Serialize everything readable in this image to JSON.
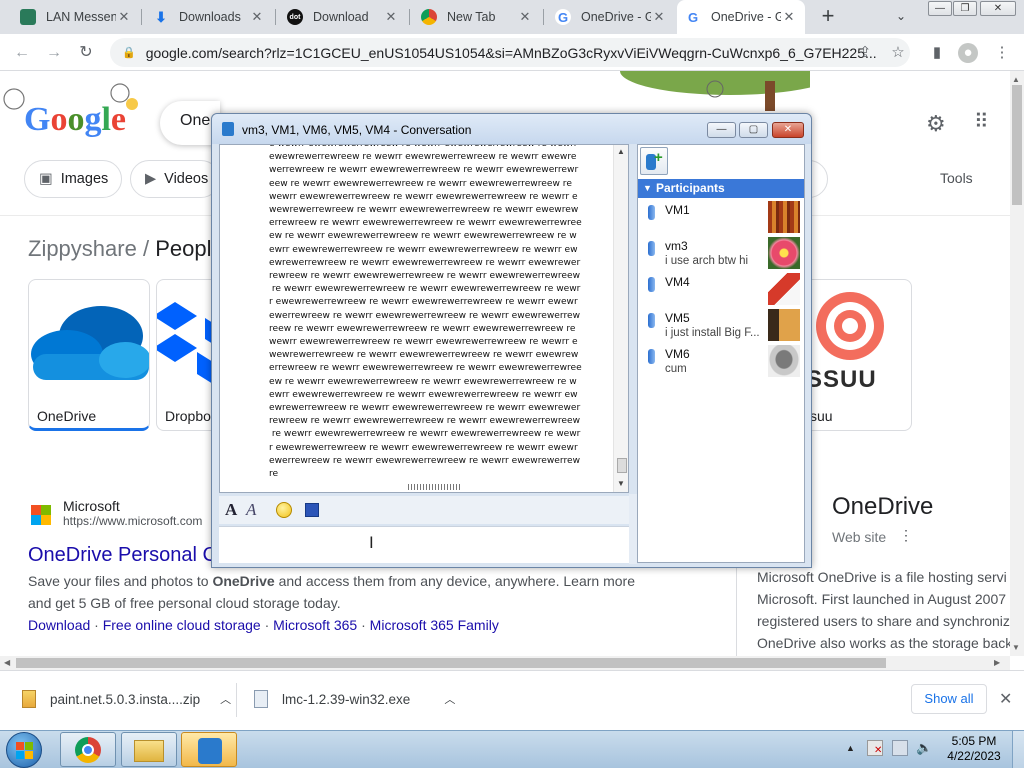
{
  "tabs": [
    {
      "label": "LAN Messen",
      "icon": "lan-messenger-icon"
    },
    {
      "label": "Downloads",
      "icon": "download-icon"
    },
    {
      "label": "Download",
      "icon": "dot-icon"
    },
    {
      "label": "New Tab",
      "icon": "chrome-icon"
    },
    {
      "label": "OneDrive - G",
      "icon": "google-icon"
    },
    {
      "label": "OneDrive - G",
      "icon": "google-icon",
      "active": true
    }
  ],
  "browser": {
    "url": "google.com/search?rlz=1C1GCEU_enUS1054US1054&si=AMnBZoG3cRyxvViEiVWeqgrn-CuWcnxp6_6_G7EH225...",
    "new_tab": "+",
    "tab_close": "✕"
  },
  "google": {
    "logo": "Google",
    "query": "One",
    "chips": [
      "Images",
      "Videos"
    ],
    "tools": "Tools",
    "breadcrumb": [
      "Zippyshare",
      "/",
      "People"
    ],
    "cards": [
      "OneDrive",
      "Dropbo",
      "suu"
    ],
    "issuu_text": "SSUU",
    "result": {
      "site": "Microsoft",
      "url": "https://www.microsoft.com",
      "title": "OneDrive Personal C",
      "snippet_pre": "Save your files and photos to ",
      "snippet_bold": "OneDrive",
      "snippet_post": " and access them from any device, anywhere. Learn more",
      "snippet_line2": "and get 5 GB of free personal cloud storage today.",
      "links": [
        "Download",
        "Free online cloud storage",
        "Microsoft 365",
        "Microsoft 365 Family"
      ],
      "separator": "·"
    },
    "kp": {
      "title": "OneDrive",
      "subtitle": "Web site",
      "more": "⋮",
      "lines": [
        "Microsoft OneDrive is a file hosting servi",
        "Microsoft. First launched in August 2007",
        "registered users to share and synchroniz",
        "OneDrive also works as the storage back"
      ]
    }
  },
  "conversation": {
    "title": "vm3, VM1, VM6, VM5, VM4 - Conversation",
    "message_lines": [
      "e wewrr ewewrewerrewreew re wewrr ewewrewerrewreew re wewrr",
      "ewewrewerrewreew re wewrr ewewrewerrewreew re wewrr ewewre",
      "werrewreew re wewrr ewewrewerrewreew re wewrr ewewrewerrewr",
      "eew re wewrr ewewrewerrewreew re wewrr ewewrewerrewreew re",
      "wewrr ewewrewerrewreew re wewrr ewewrewerrewreew re wewrr e",
      "wewrewerrewreew re wewrr ewewrewerrewreew re wewrr ewewrew",
      "errewreew re wewrr ewewrewerrewreew re wewrr ewewrewerrewree",
      "ew re wewrr ewewrewerrewreew re wewrr ewewrewerrewreew re w",
      "ewrr ewewrewerrewreew re wewrr ewewrewerrewreew re wewrr ew",
      "ewrewerrewreew re wewrr ewewrewerrewreew re wewrr ewewrewer",
      "rewreew re wewrr ewewrewerrewreew re wewrr ewewrewerrewreew",
      " re wewrr ewewrewerrewreew re wewrr ewewrewerrewreew re wewr",
      "r ewewrewerrewreew re wewrr ewewrewerrewreew re wewrr ewewr",
      "ewerrewreew re wewrr ewewrewerrewreew re wewrr ewewrewerrew",
      "reew re wewrr ewewrewerrewreew re wewrr ewewrewerrewreew re",
      "wewrr ewewrewerrewreew re wewrr ewewrewerrewreew re wewrr e",
      "wewrewerrewreew re wewrr ewewrewerrewreew re wewrr ewewrew",
      "errewreew re wewrr ewewrewerrewreew re wewrr ewewrewerrewree",
      "ew re wewrr ewewrewerrewreew re wewrr ewewrewerrewreew re w",
      "ewrr ewewrewerrewreew re wewrr ewewrewerrewreew re wewrr ew",
      "ewrewerrewreew re wewrr ewewrewerrewreew re wewrr ewewrewer",
      "rewreew re wewrr ewewrewerrewreew re wewrr ewewrewerrewreew",
      " re wewrr ewewrewerrewreew re wewrr ewewrewerrewreew re wewr",
      "r ewewrewerrewreew re wewrr ewewrewerrewreew re wewrr ewewr",
      "ewerrewreew re wewrr ewewrewerrewreew re wewrr ewewrewerrew",
      "re"
    ],
    "participants_header": "Participants",
    "participants": [
      {
        "name": "VM1",
        "status": ""
      },
      {
        "name": "vm3",
        "status": "i use arch btw hi"
      },
      {
        "name": "VM4",
        "status": ""
      },
      {
        "name": "VM5",
        "status": "i just install Big F..."
      },
      {
        "name": "VM6",
        "status": "cum"
      }
    ]
  },
  "downloads": [
    {
      "name": "paint.net.5.0.3.insta....zip"
    },
    {
      "name": "lmc-1.2.39-win32.exe"
    }
  ],
  "show_all": "Show all",
  "clock": {
    "time": "5:05 PM",
    "date": "4/22/2023"
  }
}
